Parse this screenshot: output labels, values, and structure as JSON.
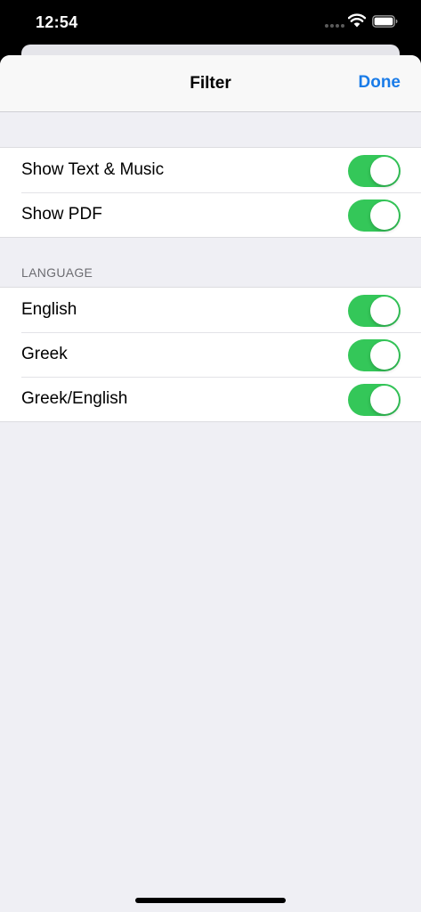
{
  "status_bar": {
    "time": "12:54",
    "icons": [
      "signal-icon",
      "wifi-icon",
      "battery-icon"
    ]
  },
  "nav": {
    "title": "Filter",
    "done_label": "Done"
  },
  "colors": {
    "accent": "#1a7ce8",
    "toggle_on": "#34c759",
    "background": "#efeff4"
  },
  "content_group": {
    "rows": [
      {
        "label": "Show Text & Music",
        "enabled": true
      },
      {
        "label": "Show PDF",
        "enabled": true
      }
    ]
  },
  "language_group": {
    "header": "LANGUAGE",
    "rows": [
      {
        "label": "English",
        "enabled": true
      },
      {
        "label": "Greek",
        "enabled": true
      },
      {
        "label": "Greek/English",
        "enabled": true
      }
    ]
  }
}
